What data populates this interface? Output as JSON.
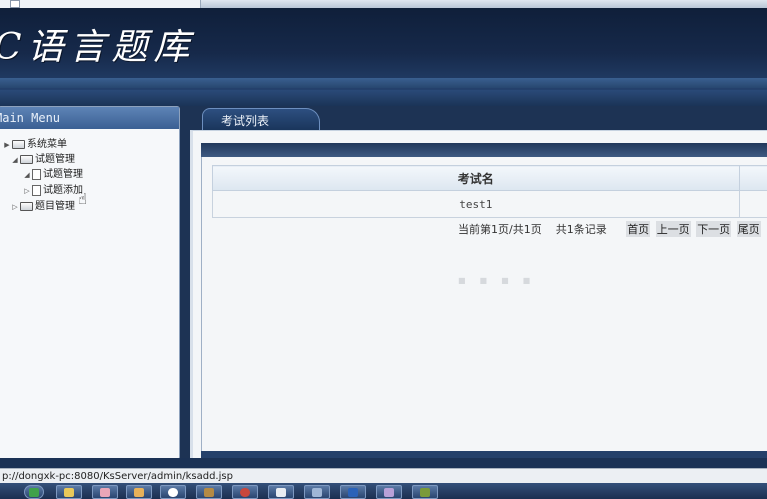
{
  "header": {
    "title": "C语言题库"
  },
  "sidebar": {
    "heading": "Main Menu",
    "tree": [
      {
        "label": "系统菜单"
      },
      {
        "label": "试题管理"
      },
      {
        "label": "试题管理"
      },
      {
        "label": "试题添加"
      },
      {
        "label": "题目管理"
      }
    ]
  },
  "main": {
    "tab_label": "考试列表",
    "table": {
      "columns": [
        "考试名"
      ],
      "rows": [
        [
          "test1"
        ]
      ]
    },
    "pager": {
      "page_info": "当前第1页/共1页",
      "record_info": "共1条记录",
      "first": "首页",
      "prev": "上一页",
      "next": "下一页",
      "last": "尾页"
    }
  },
  "statusbar": {
    "url": "p://dongxk-pc:8080/KsServer/admin/ksadd.jsp"
  },
  "taskbar": {
    "icons": [
      "start-orb-icon",
      "explorer-icon",
      "eraser-icon",
      "paint-icon",
      "sogou-icon",
      "archive-icon",
      "record-icon",
      "document-icon",
      "tool-icon",
      "photoshop-icon",
      "settings-icon",
      "media-icon"
    ]
  },
  "colors": {
    "header_bg": "#16294a",
    "panel_bg": "#f4f6f8",
    "accent": "#3a5f93"
  }
}
